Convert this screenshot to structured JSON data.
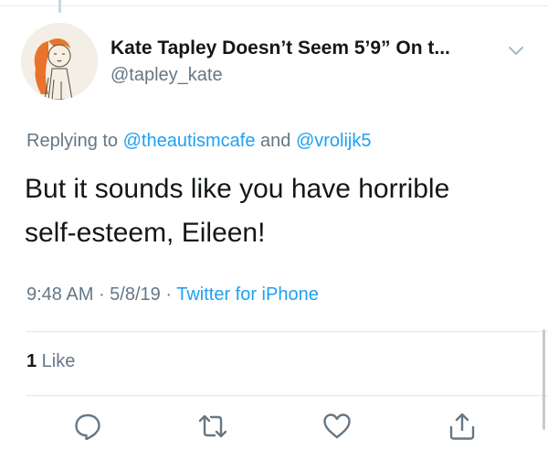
{
  "tweet": {
    "author": {
      "display_name": "Kate Tapley Doesn’t Seem 5’9” On t...",
      "handle": "@tapley_kate"
    },
    "reply_prefix": "Replying to ",
    "reply_to": [
      "@theautismcafe",
      "@vrolijk5"
    ],
    "reply_conjunction": " and ",
    "text_lines": [
      "But it sounds like you have horrible",
      "self-esteem, Eileen!"
    ],
    "time": "9:48 AM",
    "date": "5/8/19",
    "separator": " · ",
    "source": "Twitter for iPhone",
    "likes": {
      "count": "1",
      "label": " Like"
    }
  },
  "actions": {
    "reply_icon": "reply-icon",
    "retweet_icon": "retweet-icon",
    "like_icon": "heart-icon",
    "share_icon": "share-icon"
  },
  "colors": {
    "link": "#1da1f2",
    "secondary_text": "#657786",
    "primary_text": "#14171a",
    "divider": "#e1e8ed"
  }
}
